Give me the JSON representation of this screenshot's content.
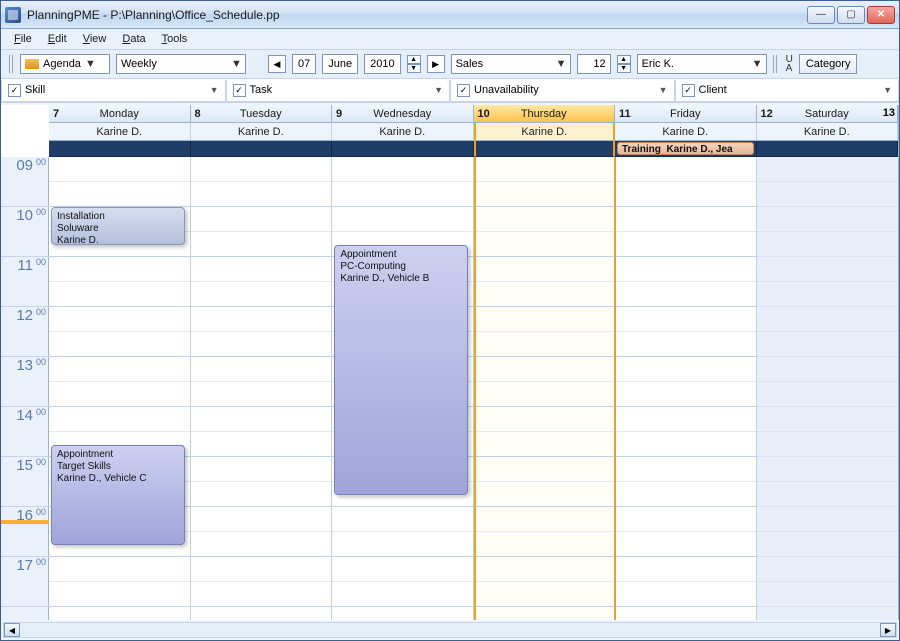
{
  "window": {
    "title": "PlanningPME - P:\\Planning\\Office_Schedule.pp"
  },
  "menu": {
    "file": "File",
    "edit": "Edit",
    "view": "View",
    "data": "Data",
    "tools": "Tools"
  },
  "toolbar": {
    "view_mode": "Agenda",
    "period": "Weekly",
    "date_day": "07",
    "date_month": "June",
    "date_year": "2010",
    "department": "Sales",
    "count": "12",
    "user": "Eric K.",
    "letter_u": "U",
    "letter_a": "A",
    "category_btn": "Category"
  },
  "filters": {
    "skill": "Skill",
    "task": "Task",
    "unavailability": "Unavailability",
    "client": "Client"
  },
  "days": [
    {
      "num": "7",
      "name": "Monday",
      "resource": "Karine D.",
      "today": false,
      "weekend": false
    },
    {
      "num": "8",
      "name": "Tuesday",
      "resource": "Karine D.",
      "today": false,
      "weekend": false
    },
    {
      "num": "9",
      "name": "Wednesday",
      "resource": "Karine D.",
      "today": false,
      "weekend": false
    },
    {
      "num": "10",
      "name": "Thursday",
      "resource": "Karine D.",
      "today": true,
      "weekend": false
    },
    {
      "num": "11",
      "name": "Friday",
      "resource": "Karine D.",
      "today": false,
      "weekend": false
    },
    {
      "num": "12",
      "name": "Saturday",
      "resource": "Karine D.",
      "today": false,
      "weekend": true
    }
  ],
  "last_day_num": "13",
  "hours": [
    "09",
    "10",
    "11",
    "12",
    "13",
    "14",
    "15",
    "16",
    "17"
  ],
  "minute_label": "00",
  "allday_events": [
    {
      "day": 4,
      "title": "Training",
      "who": "Karine D., Jea",
      "style": "orange"
    }
  ],
  "events": [
    {
      "day": 0,
      "start": "10:00",
      "end": "10:45",
      "lines": [
        "Installation",
        "Soluware",
        "Karine D."
      ],
      "style": "blue"
    },
    {
      "day": 0,
      "start": "14:45",
      "end": "16:45",
      "lines": [
        "Appointment",
        "Target Skills",
        "Karine D., Vehicle C"
      ],
      "style": "purple"
    },
    {
      "day": 2,
      "start": "10:45",
      "end": "15:45",
      "lines": [
        "Appointment",
        "PC-Computing",
        "Karine D., Vehicle B"
      ],
      "style": "purple"
    }
  ],
  "now_hour": "16:15"
}
